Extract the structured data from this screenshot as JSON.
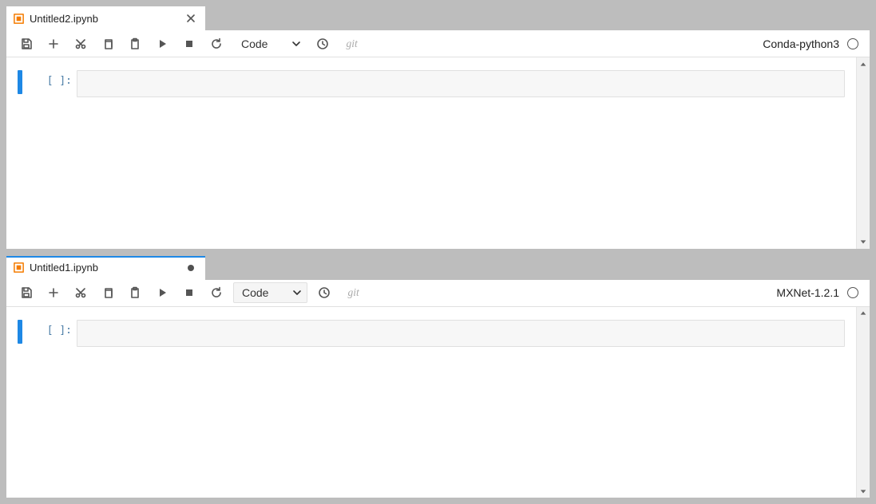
{
  "panes": [
    {
      "tab": {
        "title": "Untitled2.ipynb",
        "dirty": false
      },
      "toolbar": {
        "cell_type": "Code",
        "git_label": "git",
        "kernel": "Conda-python3",
        "cell_type_boxed": false
      },
      "cell": {
        "prompt": "[ ]:"
      }
    },
    {
      "tab": {
        "title": "Untitled1.ipynb",
        "dirty": true
      },
      "toolbar": {
        "cell_type": "Code",
        "git_label": "git",
        "kernel": "MXNet-1.2.1",
        "cell_type_boxed": true
      },
      "cell": {
        "prompt": "[ ]:"
      }
    }
  ]
}
